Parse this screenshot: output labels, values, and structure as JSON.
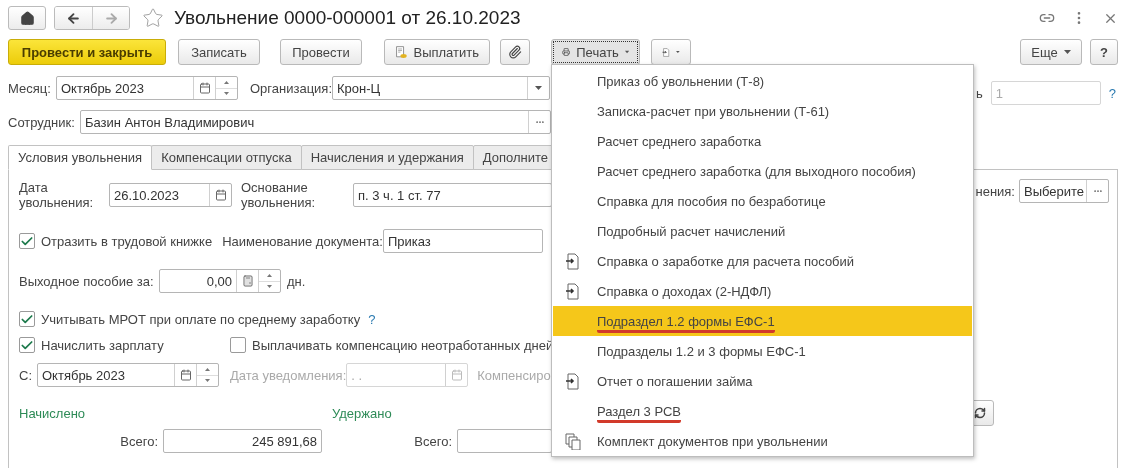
{
  "window": {
    "title": "Увольнение 0000-000001 от 26.10.2023",
    "favorite": false
  },
  "toolbar": {
    "buttons": [
      {
        "kind": "primary",
        "label": "Провести и закрыть"
      },
      {
        "kind": "plain",
        "label": "Записать"
      },
      {
        "kind": "plain",
        "label": "Провести"
      },
      {
        "kind": "pay",
        "label": "Выплатить"
      },
      {
        "kind": "attach"
      }
    ],
    "print": {
      "label": "Печать",
      "expanded": true
    },
    "more": "Еще",
    "help": "?"
  },
  "header": {
    "month_label": "Месяц:",
    "month": "Октябрь 2023",
    "org_label": "Организация:",
    "org": "Крон-Ц",
    "cut_label": "ь",
    "count": "1",
    "count_help": "?",
    "employee_label": "Сотрудник:",
    "employee": "Базин Антон Владимирович"
  },
  "tabs": [
    {
      "label": "Условия увольнения",
      "selected": true
    },
    {
      "label": "Компенсации отпуска",
      "selected": false
    },
    {
      "label": "Начисления и удержания",
      "selected": false
    },
    {
      "label": "Дополните",
      "selected": false
    }
  ],
  "conditions": {
    "date_label": "Дата увольнения:",
    "date": "26.10.2023",
    "basis_label": "Основание увольнения:",
    "basis": "п. 3 ч. 1 ст. 77",
    "reason_label": "нения:",
    "reason": "Выберите",
    "workbook": {
      "label": "Отразить в трудовой книжке",
      "checked": true
    },
    "doc_label": "Наименование документа:",
    "doc": "Приказ",
    "severance_label": "Выходное пособие за:",
    "severance": "0,00",
    "severance_unit": "дн.",
    "mrot": {
      "label": "Учитывать МРОТ при оплате по среднему заработку",
      "checked": true
    },
    "mrot_help": "?",
    "salary": {
      "label": "Начислить зарплату",
      "checked": true
    },
    "compensation": {
      "label": "Выплачивать компенсацию неотработанных дней",
      "checked": false
    },
    "from_label": "С:",
    "from": "Октябрь 2023",
    "notice_label": "Дата уведомления:",
    "notice": " .  .",
    "notice_disabled": true,
    "compensate_label": "Компенсиро",
    "accrued_title": "Начислено",
    "withheld_title": "Удержано",
    "accrued_total_label": "Всего:",
    "accrued_total": "245 891,68",
    "withheld_total_label": "Всего:"
  },
  "print_menu": {
    "items": [
      {
        "label": "Приказ об увольнении (Т-8)",
        "kind": "plain",
        "selected": false,
        "underlined": false
      },
      {
        "label": "Записка-расчет при увольнении (Т-61)",
        "kind": "plain",
        "selected": false,
        "underlined": false
      },
      {
        "label": "Расчет среднего заработка",
        "kind": "plain",
        "selected": false,
        "underlined": false
      },
      {
        "label": "Расчет среднего заработка (для выходного пособия)",
        "kind": "plain",
        "selected": false,
        "underlined": false
      },
      {
        "label": "Справка для пособия по безработице",
        "kind": "plain",
        "selected": false,
        "underlined": false
      },
      {
        "label": "Подробный расчет начислений",
        "kind": "plain",
        "selected": false,
        "underlined": false
      },
      {
        "label": "Справка о заработке для расчета пособий",
        "kind": "export",
        "selected": false,
        "underlined": false
      },
      {
        "label": "Справка о доходах (2-НДФЛ)",
        "kind": "export",
        "selected": false,
        "underlined": false
      },
      {
        "label": "Подраздел 1.2 формы ЕФС-1",
        "kind": "plain",
        "selected": true,
        "underlined": true
      },
      {
        "label": "Подразделы 1.2 и 3 формы ЕФС-1",
        "kind": "plain",
        "selected": false,
        "underlined": false
      },
      {
        "label": "Отчет о погашении займа",
        "kind": "export",
        "selected": false,
        "underlined": false
      },
      {
        "label": "Раздел 3 РСВ",
        "kind": "plain",
        "selected": false,
        "underlined": true
      },
      {
        "label": "Комплект документов при увольнении",
        "kind": "set",
        "selected": false,
        "underlined": false
      }
    ]
  }
}
